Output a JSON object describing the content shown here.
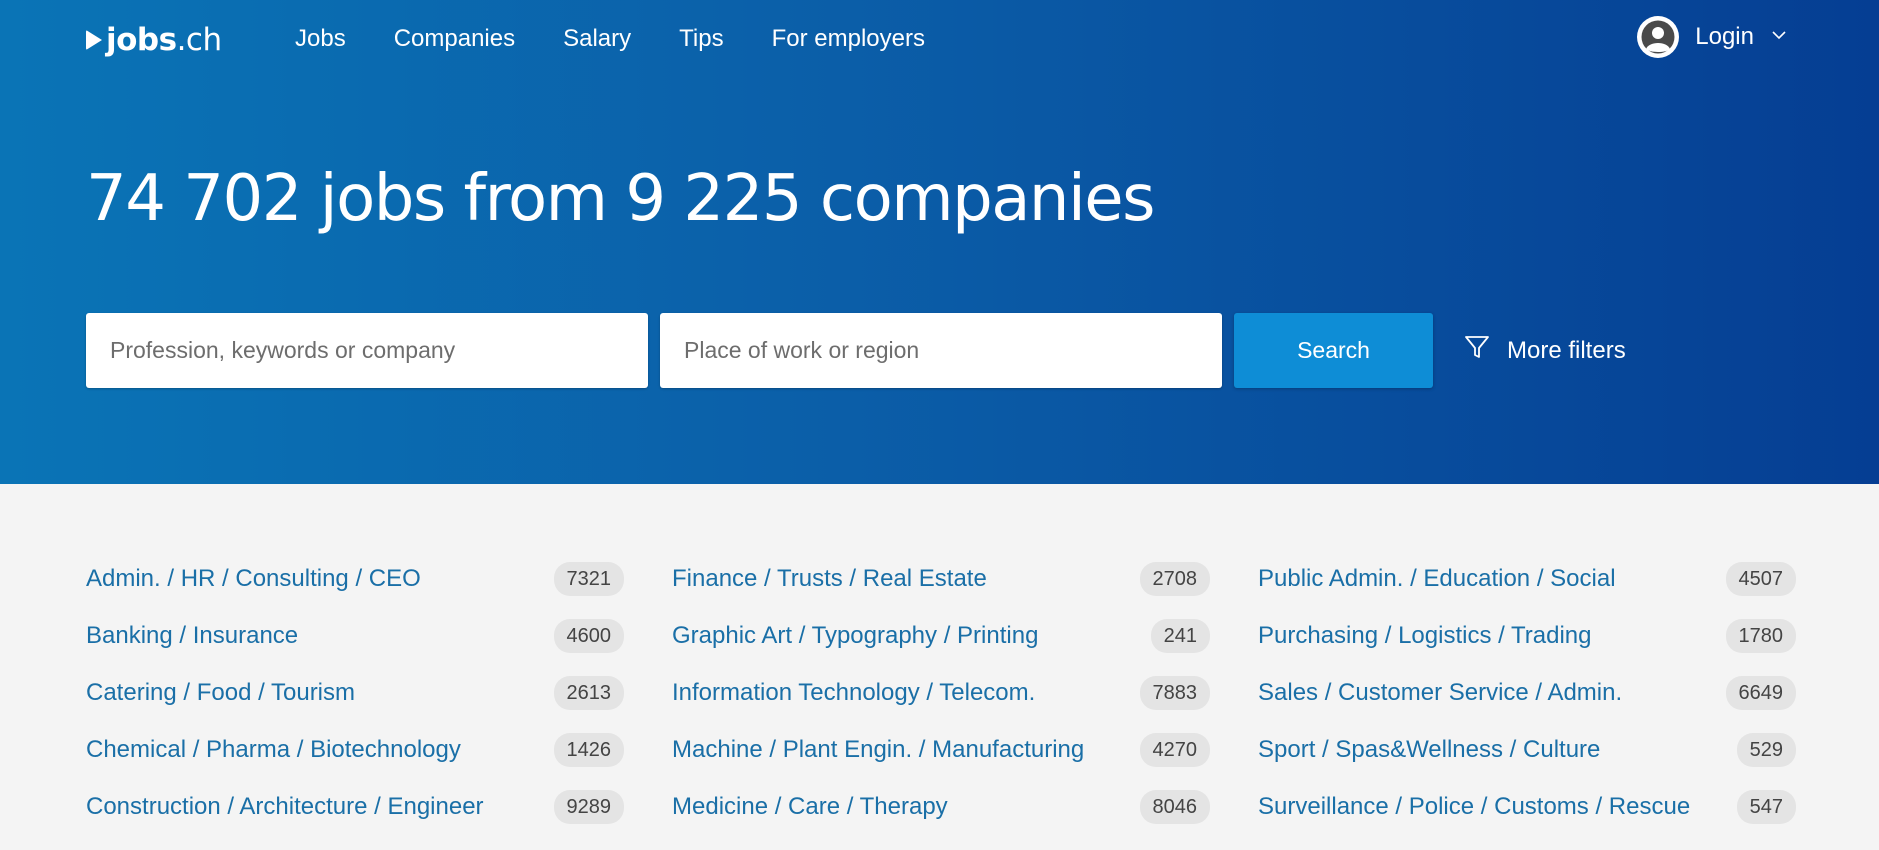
{
  "brand": {
    "name_bold": "jobs",
    "name_light": ".ch"
  },
  "nav": [
    {
      "label": "Jobs"
    },
    {
      "label": "Companies"
    },
    {
      "label": "Salary"
    },
    {
      "label": "Tips"
    },
    {
      "label": "For employers"
    }
  ],
  "login": {
    "label": "Login"
  },
  "hero": {
    "headline": "74 702 jobs from 9 225 companies"
  },
  "search": {
    "keywords_placeholder": "Profession, keywords or company",
    "location_placeholder": "Place of work or region",
    "button_label": "Search",
    "more_filters_label": "More filters"
  },
  "colors": {
    "hero_gradient_start": "#0a74b6",
    "hero_gradient_end": "#053e93",
    "search_button": "#0e8dd6",
    "category_link": "#1a6fa7",
    "page_background": "#f4f4f4"
  },
  "icons": [
    "play-logo-icon",
    "avatar-icon",
    "chevron-down-icon",
    "filter-funnel-icon"
  ],
  "categories": {
    "columns": [
      [
        {
          "label": "Admin. / HR / Consulting / CEO",
          "count": "7321"
        },
        {
          "label": "Banking / Insurance",
          "count": "4600"
        },
        {
          "label": "Catering / Food / Tourism",
          "count": "2613"
        },
        {
          "label": "Chemical / Pharma / Biotechnology",
          "count": "1426"
        },
        {
          "label": "Construction / Architecture / Engineer",
          "count": "9289"
        }
      ],
      [
        {
          "label": "Finance / Trusts / Real Estate",
          "count": "2708"
        },
        {
          "label": "Graphic Art / Typography / Printing",
          "count": "241"
        },
        {
          "label": "Information Technology / Telecom.",
          "count": "7883"
        },
        {
          "label": "Machine / Plant Engin. / Manufacturing",
          "count": "4270"
        },
        {
          "label": "Medicine / Care / Therapy",
          "count": "8046"
        }
      ],
      [
        {
          "label": "Public Admin. / Education / Social",
          "count": "4507"
        },
        {
          "label": "Purchasing / Logistics / Trading",
          "count": "1780"
        },
        {
          "label": "Sales / Customer Service / Admin.",
          "count": "6649"
        },
        {
          "label": "Sport / Spas&Wellness / Culture",
          "count": "529"
        },
        {
          "label": "Surveillance / Police / Customs / Rescue",
          "count": "547"
        }
      ]
    ]
  }
}
